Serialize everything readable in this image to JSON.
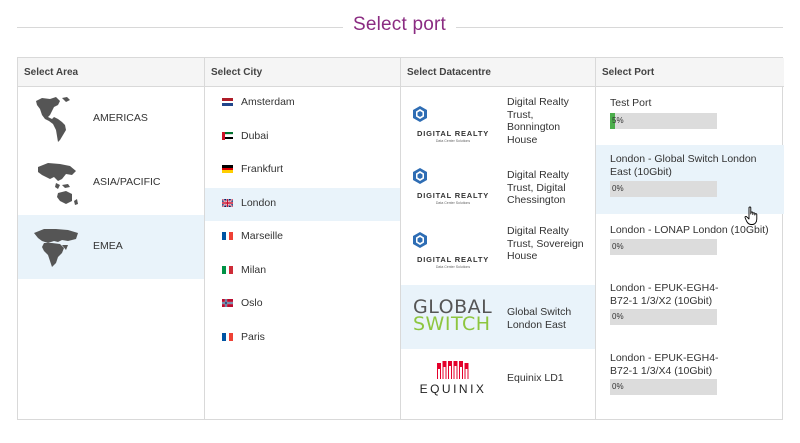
{
  "header": {
    "title": "Select port"
  },
  "columns": {
    "area": "Select Area",
    "city": "Select City",
    "datacentre": "Select Datacentre",
    "port": "Select Port"
  },
  "areas": [
    {
      "label": "AMERICAS",
      "icon": "americas-map-icon",
      "selected": false
    },
    {
      "label": "ASIA/PACIFIC",
      "icon": "asia-pacific-map-icon",
      "selected": false
    },
    {
      "label": "EMEA",
      "icon": "emea-map-icon",
      "selected": true
    }
  ],
  "cities": [
    {
      "label": "Amsterdam",
      "flag": "netherlands-flag-icon",
      "selected": false
    },
    {
      "label": "Dubai",
      "flag": "uae-flag-icon",
      "selected": false
    },
    {
      "label": "Frankfurt",
      "flag": "germany-flag-icon",
      "selected": false
    },
    {
      "label": "London",
      "flag": "uk-flag-icon",
      "selected": true
    },
    {
      "label": "Marseille",
      "flag": "france-flag-icon",
      "selected": false
    },
    {
      "label": "Milan",
      "flag": "italy-flag-icon",
      "selected": false
    },
    {
      "label": "Oslo",
      "flag": "norway-flag-icon",
      "selected": false
    },
    {
      "label": "Paris",
      "flag": "france-flag-icon",
      "selected": false
    }
  ],
  "datacentres": [
    {
      "name": "Digital Realty Trust, Bonnington House",
      "logo": "digital-realty-logo",
      "selected": false
    },
    {
      "name": "Digital Realty Trust, Digital Chessington",
      "logo": "digital-realty-logo",
      "selected": false
    },
    {
      "name": "Digital Realty Trust, Sovereign House",
      "logo": "digital-realty-logo",
      "selected": false
    },
    {
      "name": "Global Switch London East",
      "logo": "global-switch-logo",
      "selected": true
    },
    {
      "name": "Equinix LD1",
      "logo": "equinix-logo",
      "selected": false
    }
  ],
  "logos": {
    "digital_realty": {
      "text": "DIGITAL REALTY",
      "sub": "Data Center Solutions"
    },
    "global_switch": {
      "line1": "GLOBAL",
      "line2": "SWITCH"
    },
    "equinix": {
      "text": "EQUINIX"
    }
  },
  "ports": [
    {
      "name": "Test Port",
      "usage_label": "5%",
      "usage": 5,
      "selected": false
    },
    {
      "name": "London - Global Switch London East (10Gbit)",
      "usage_label": "0%",
      "usage": 0,
      "selected": true
    },
    {
      "name": "London - LONAP London (10Gbit)",
      "usage_label": "0%",
      "usage": 0,
      "selected": false
    },
    {
      "name": "London - EPUK-EGH4-B72-1 1/3/X2 (10Gbit)",
      "usage_label": "0%",
      "usage": 0,
      "selected": false
    },
    {
      "name": "London - EPUK-EGH4-B72-1 1/3/X4 (10Gbit)",
      "usage_label": "0%",
      "usage": 0,
      "selected": false
    }
  ],
  "colors": {
    "accent_title": "#8b2c82",
    "selected_row": "#e9f3fa",
    "bar_fill": "#4cae4c",
    "bar_track": "#dcdcdc",
    "global_switch_green": "#8dc63f",
    "equinix_red": "#e4002b"
  }
}
